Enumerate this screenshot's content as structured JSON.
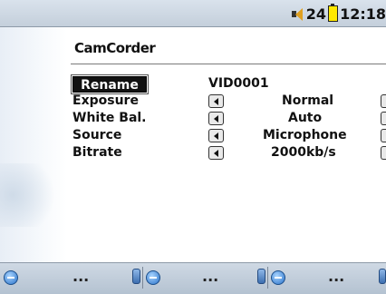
{
  "statusbar": {
    "volume": "24",
    "clock": "12:18"
  },
  "title": "CamCorder",
  "settings": [
    {
      "label": "Rename",
      "value": "VID0001"
    },
    {
      "label": "Exposure",
      "value": "Normal"
    },
    {
      "label": "White Bal.",
      "value": "Auto"
    },
    {
      "label": "Source",
      "value": "Microphone"
    },
    {
      "label": "Bitrate",
      "value": "2000kb/s"
    }
  ],
  "taskbar": {
    "slots": [
      {
        "text": "..."
      },
      {
        "text": "..."
      },
      {
        "text": "..."
      }
    ]
  },
  "icons": {
    "volume": "speaker-icon",
    "battery": "battery-icon",
    "slot": "minus-circle-icon",
    "handset": "handset-icon"
  },
  "colors": {
    "statusbar": "#c4cfdb",
    "battery": "#ffe800",
    "selected": "#111111"
  }
}
